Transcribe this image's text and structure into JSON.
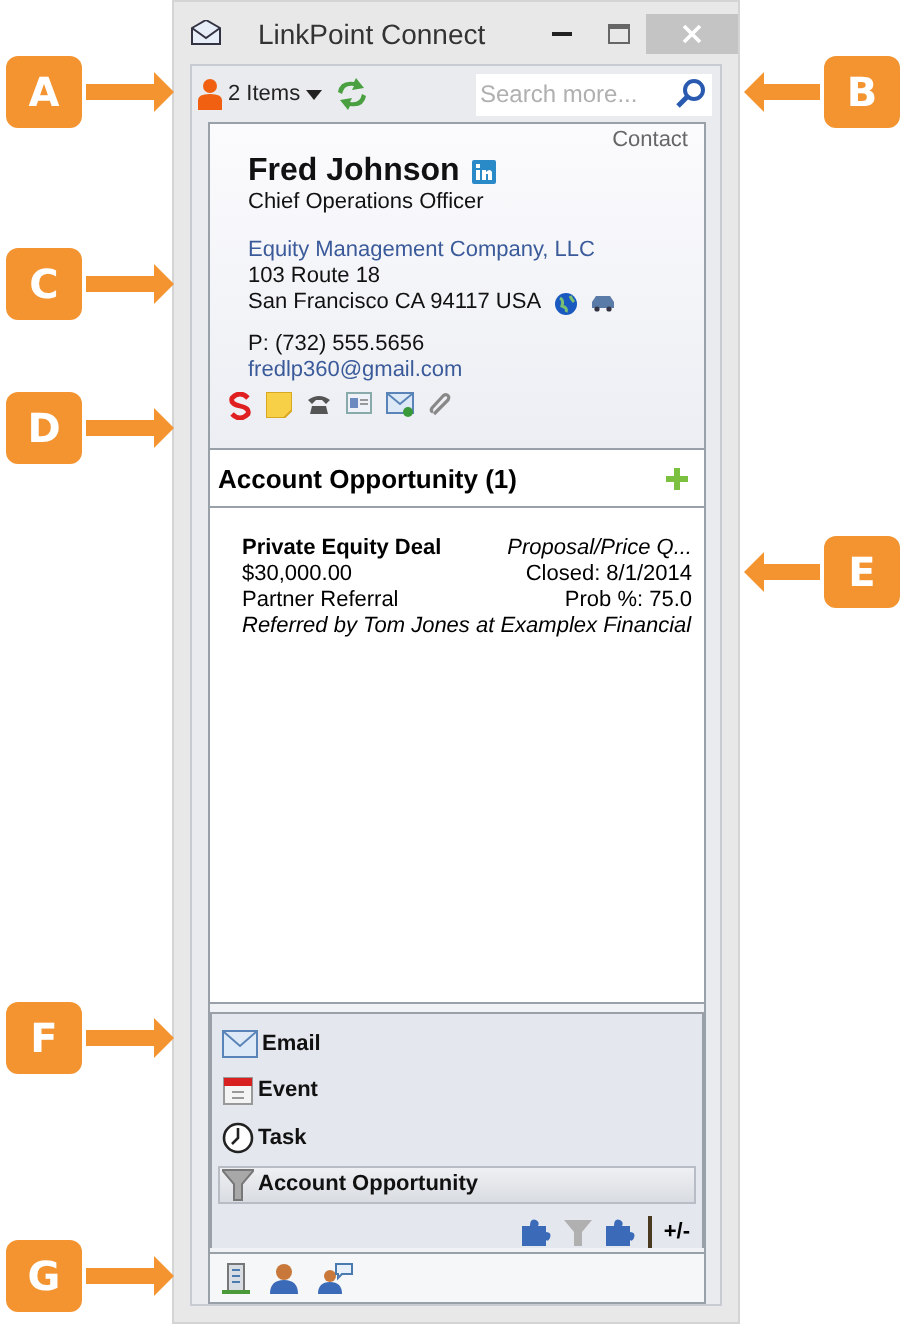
{
  "window": {
    "title": "LinkPoint Connect"
  },
  "toolbar": {
    "items_label": "2 Items",
    "search": {
      "placeholder": "Search more..."
    }
  },
  "contact": {
    "type_label": "Contact",
    "name": "Fred Johnson",
    "title": "Chief Operations Officer",
    "company": "Equity Management Company, LLC",
    "address_line1": "103 Route 18",
    "address_line2": "San Francisco CA 94117 USA",
    "phone": "P: (732) 555.5656",
    "email": "fredlp360@gmail.com"
  },
  "opportunity_section": {
    "title": "Account Opportunity (1)",
    "items": [
      {
        "name": "Private Equity Deal",
        "stage": "Proposal/Price Q...",
        "amount": "$30,000.00",
        "closed": "Closed: 8/1/2014",
        "source": "Partner Referral",
        "probability": "Prob %: 75.0",
        "note": "Referred by Tom Jones at Examplex Financial"
      }
    ]
  },
  "nav": {
    "items": [
      {
        "label": "Email",
        "kind": "email",
        "selected": false
      },
      {
        "label": "Event",
        "kind": "event",
        "selected": false
      },
      {
        "label": "Task",
        "kind": "task",
        "selected": false
      },
      {
        "label": "Account Opportunity",
        "kind": "opportunity",
        "selected": true
      }
    ],
    "toggle_label": "+/-"
  },
  "callouts": [
    {
      "label": "A"
    },
    {
      "label": "B"
    },
    {
      "label": "C"
    },
    {
      "label": "D"
    },
    {
      "label": "E"
    },
    {
      "label": "F"
    },
    {
      "label": "G"
    }
  ]
}
